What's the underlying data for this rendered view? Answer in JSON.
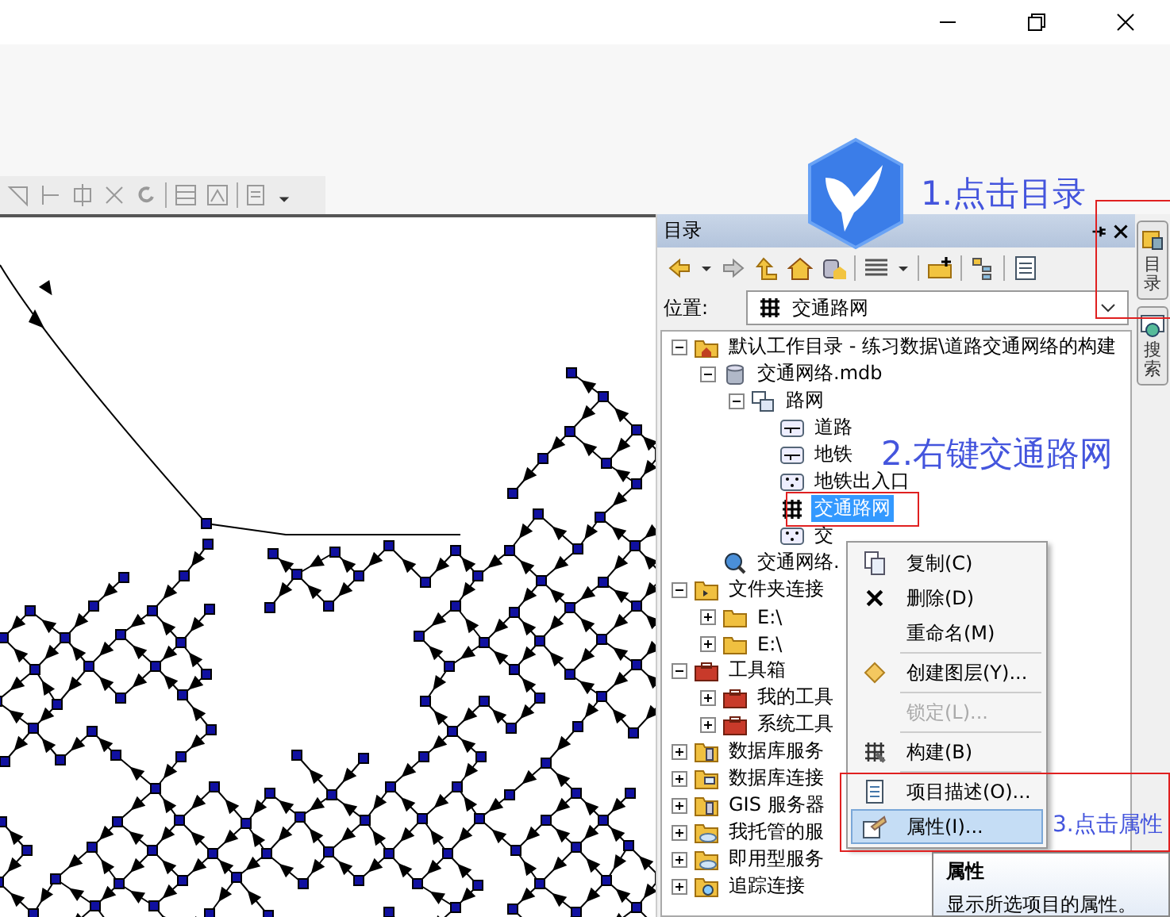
{
  "catalog": {
    "title": "目录",
    "location_label": "位置:",
    "location_value": "交通路网",
    "tree": [
      {
        "label": "默认工作目录 - 练习数据\\道路交通网络的构建",
        "kind": "home-folder",
        "expanded": true,
        "selected": false,
        "children": [
          {
            "label": "交通网络.mdb",
            "kind": "database",
            "expanded": true,
            "selected": false,
            "children": [
              {
                "label": "路网",
                "kind": "dataset",
                "expanded": true,
                "selected": false,
                "children": [
                  {
                    "label": "道路",
                    "kind": "line",
                    "selected": false
                  },
                  {
                    "label": "地铁",
                    "kind": "line",
                    "selected": false
                  },
                  {
                    "label": "地铁出入口",
                    "kind": "point",
                    "selected": false
                  },
                  {
                    "label": "交通路网",
                    "kind": "network",
                    "selected": true
                  },
                  {
                    "label": "交",
                    "kind": "point",
                    "selected": false
                  }
                ]
              }
            ]
          },
          {
            "label": "交通网络.",
            "kind": "locator",
            "selected": false
          }
        ]
      },
      {
        "label": "文件夹连接",
        "kind": "folder-link",
        "expanded": true,
        "selected": false,
        "children": [
          {
            "label": "E:\\",
            "kind": "folder",
            "expanded": false,
            "selected": false
          },
          {
            "label": "E:\\",
            "kind": "folder",
            "expanded": false,
            "selected": false
          }
        ]
      },
      {
        "label": "工具箱",
        "kind": "toolbox",
        "expanded": true,
        "selected": false,
        "children": [
          {
            "label": "我的工具",
            "kind": "toolbox",
            "expanded": false,
            "selected": false
          },
          {
            "label": "系统工具",
            "kind": "toolbox",
            "expanded": false,
            "selected": false
          }
        ]
      },
      {
        "label": "数据库服务",
        "kind": "server",
        "expanded": false,
        "selected": false
      },
      {
        "label": "数据库连接",
        "kind": "connection",
        "expanded": false,
        "selected": false
      },
      {
        "label": "GIS 服务器",
        "kind": "server",
        "expanded": false,
        "selected": false
      },
      {
        "label": "我托管的服",
        "kind": "cloud",
        "expanded": false,
        "selected": false
      },
      {
        "label": "即用型服务",
        "kind": "cloud",
        "expanded": false,
        "selected": false
      },
      {
        "label": "追踪连接",
        "kind": "tracking",
        "expanded": false,
        "selected": false
      }
    ]
  },
  "side_tabs": [
    {
      "label": "目录",
      "kind": "catalog",
      "selected": false
    },
    {
      "label": "搜索",
      "kind": "search",
      "selected": false
    }
  ],
  "context_menu": {
    "items": [
      {
        "label": "复制(C)",
        "kind": "copy",
        "separator_before": false,
        "disabled": false,
        "selected": false
      },
      {
        "label": "删除(D)",
        "kind": "delete",
        "separator_before": false,
        "disabled": false,
        "selected": false
      },
      {
        "label": "重命名(M)",
        "kind": "plain",
        "separator_before": false,
        "disabled": false,
        "selected": false
      },
      {
        "label": "创建图层(Y)...",
        "kind": "layer",
        "separator_before": true,
        "disabled": false,
        "selected": false
      },
      {
        "label": "锁定(L)...",
        "kind": "plain",
        "separator_before": true,
        "disabled": true,
        "selected": false
      },
      {
        "label": "构建(B)",
        "kind": "build",
        "separator_before": true,
        "disabled": false,
        "selected": false
      },
      {
        "label": "项目描述(O)...",
        "kind": "description",
        "separator_before": true,
        "disabled": false,
        "selected": false
      },
      {
        "label": "属性(I)...",
        "kind": "properties",
        "separator_before": false,
        "disabled": false,
        "selected": true
      }
    ]
  },
  "tooltip": {
    "title": "属性",
    "text": "显示所选项目的属性。"
  },
  "annotations": [
    "1.点击目录",
    "2.右键交通路网",
    "3.点击属性"
  ]
}
